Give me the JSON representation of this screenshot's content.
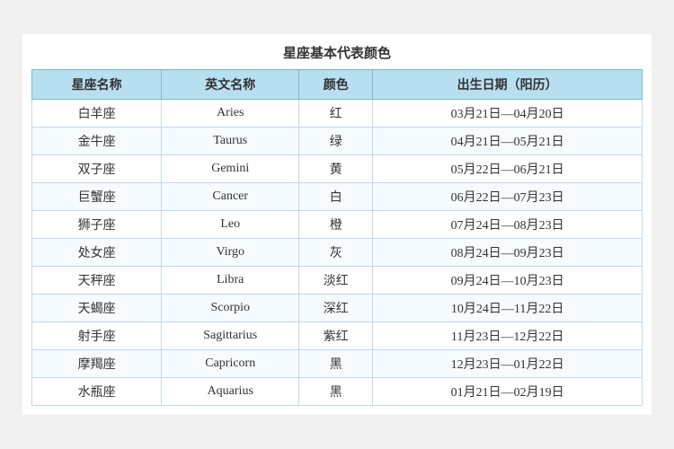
{
  "title": "星座基本代表颜色",
  "headers": [
    "星座名称",
    "英文名称",
    "颜色",
    "出生日期（阳历）"
  ],
  "rows": [
    {
      "zh": "白羊座",
      "en": "Aries",
      "color": "红",
      "dates": "03月21日—04月20日"
    },
    {
      "zh": "金牛座",
      "en": "Taurus",
      "color": "绿",
      "dates": "04月21日—05月21日"
    },
    {
      "zh": "双子座",
      "en": "Gemini",
      "color": "黄",
      "dates": "05月22日—06月21日"
    },
    {
      "zh": "巨蟹座",
      "en": "Cancer",
      "color": "白",
      "dates": "06月22日—07月23日"
    },
    {
      "zh": "狮子座",
      "en": "Leo",
      "color": "橙",
      "dates": "07月24日—08月23日"
    },
    {
      "zh": "处女座",
      "en": "Virgo",
      "color": "灰",
      "dates": "08月24日—09月23日"
    },
    {
      "zh": "天秤座",
      "en": "Libra",
      "color": "淡红",
      "dates": "09月24日—10月23日"
    },
    {
      "zh": "天蝎座",
      "en": "Scorpio",
      "color": "深红",
      "dates": "10月24日—11月22日"
    },
    {
      "zh": "射手座",
      "en": "Sagittarius",
      "color": "紫红",
      "dates": "11月23日—12月22日"
    },
    {
      "zh": "摩羯座",
      "en": "Capricorn",
      "color": "黑",
      "dates": "12月23日—01月22日"
    },
    {
      "zh": "水瓶座",
      "en": "Aquarius",
      "color": "黑",
      "dates": "01月21日—02月19日"
    }
  ]
}
